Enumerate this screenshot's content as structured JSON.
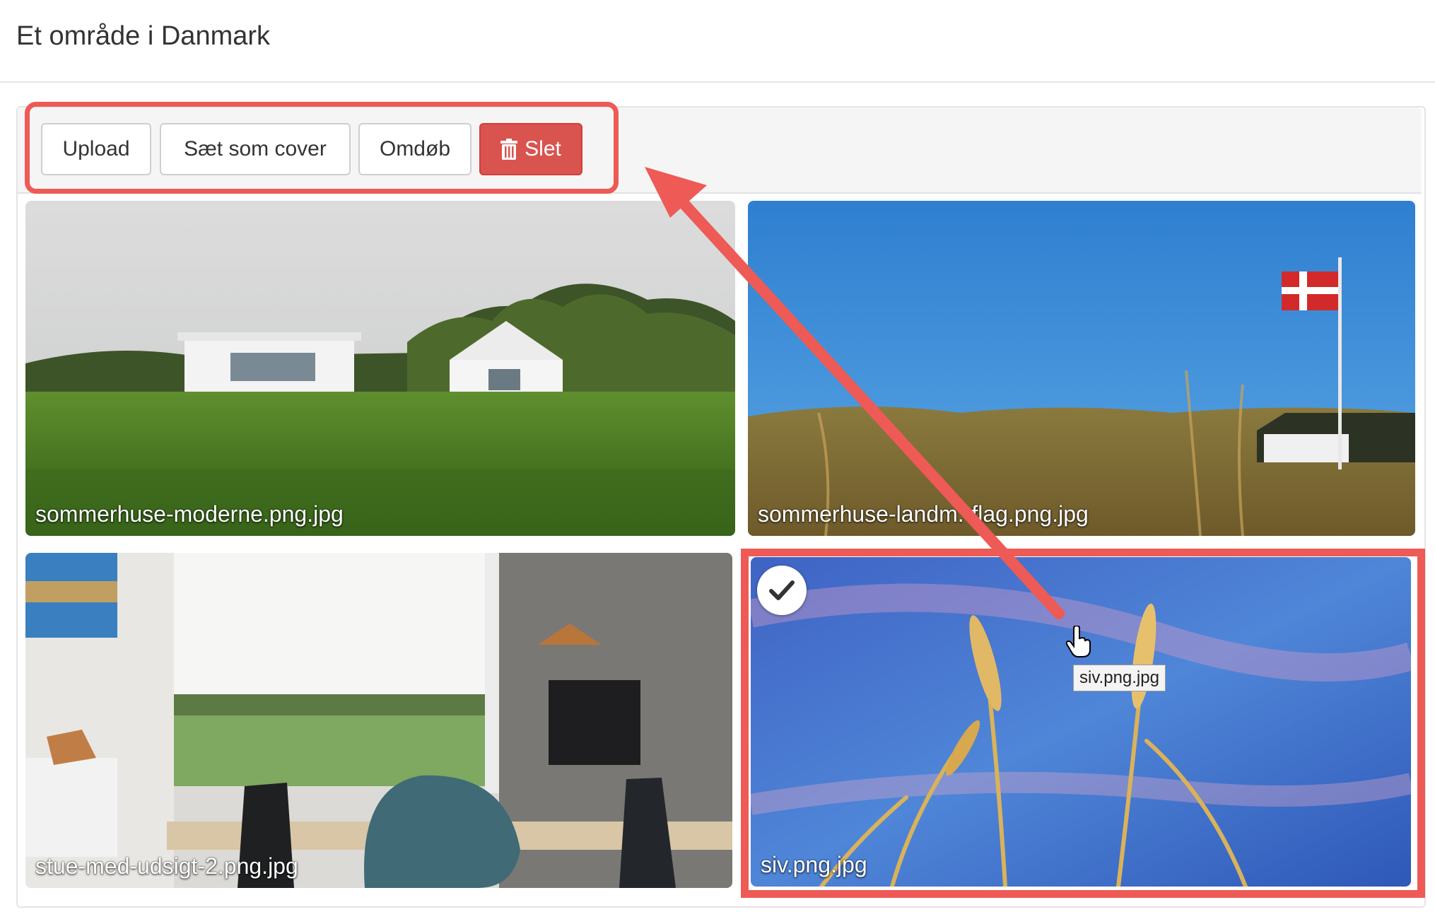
{
  "page": {
    "title": "Et område i Danmark"
  },
  "toolbar": {
    "upload_label": "Upload",
    "set_cover_label": "Sæt som cover",
    "rename_label": "Omdøb",
    "delete_label": "Slet",
    "delete_icon": "trash-icon",
    "delete_color": "#d9534f"
  },
  "gallery": {
    "images": [
      {
        "filename": "sommerhuse-moderne.png.jpg",
        "selected": false
      },
      {
        "filename": "sommerhuse-landm.-flag.png.jpg",
        "selected": false
      },
      {
        "filename": "stue-med-udsigt-2.png.jpg",
        "selected": false
      },
      {
        "filename": "siv.png.jpg",
        "selected": true
      }
    ],
    "tooltip": "siv.png.jpg",
    "selected_icon": "checkmark-icon"
  },
  "annotation": {
    "highlight_color": "#ee5a55",
    "arrow": "arrow-from-selected-image-to-toolbar"
  }
}
